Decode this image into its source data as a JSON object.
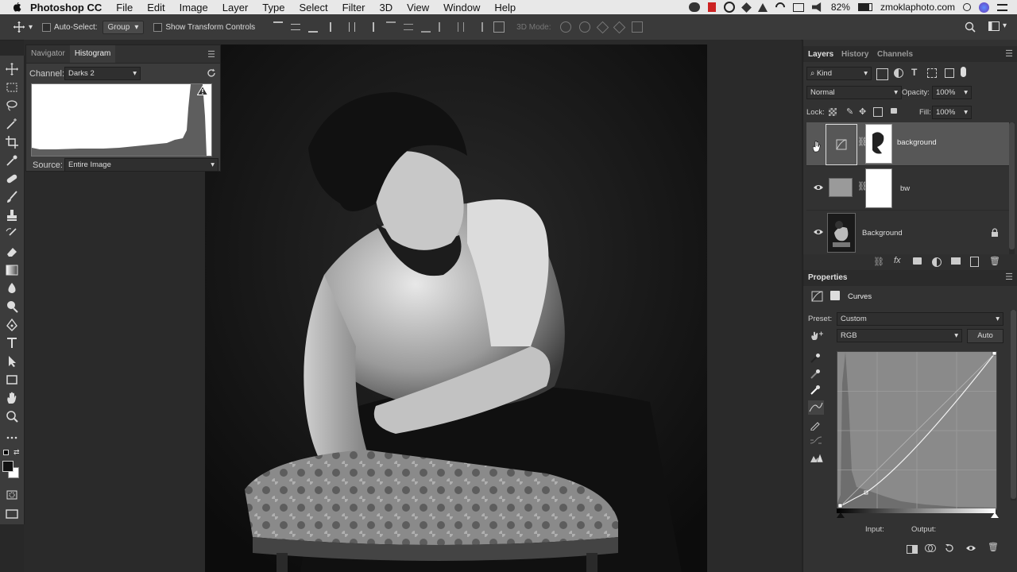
{
  "menubar": {
    "app_name": "Photoshop CC",
    "items": [
      "File",
      "Edit",
      "Image",
      "Layer",
      "Type",
      "Select",
      "Filter",
      "3D",
      "View",
      "Window",
      "Help"
    ],
    "battery": "82%",
    "site": "zmoklaphoto.com"
  },
  "options_bar": {
    "auto_select_label": "Auto-Select:",
    "auto_select_value": "Group",
    "show_transform_label": "Show Transform Controls",
    "three_d_mode_label": "3D Mode:"
  },
  "left_panel": {
    "tabs": [
      "Navigator",
      "Histogram"
    ],
    "channel_label": "Channel:",
    "channel_value": "Darks 2",
    "source_label": "Source:",
    "source_value": "Entire Image"
  },
  "layers_panel": {
    "tabs": [
      "Layers",
      "History",
      "Channels"
    ],
    "kind_filter": "Kind",
    "blend_mode": "Normal",
    "opacity_label": "Opacity:",
    "opacity_value": "100%",
    "lock_label": "Lock:",
    "fill_label": "Fill:",
    "fill_value": "100%",
    "layers": [
      {
        "name": "background",
        "selected": true
      },
      {
        "name": "bw",
        "selected": false
      },
      {
        "name": "Background",
        "selected": false,
        "locked": true
      }
    ]
  },
  "properties_panel": {
    "title": "Properties",
    "adjustment_name": "Curves",
    "preset_label": "Preset:",
    "preset_value": "Custom",
    "channel_value": "RGB",
    "auto_button": "Auto",
    "input_label": "Input:",
    "output_label": "Output:"
  },
  "colors": {
    "panel_bg": "#323232",
    "menubar_bg": "#e8e8e8",
    "selected_layer": "#575757"
  }
}
